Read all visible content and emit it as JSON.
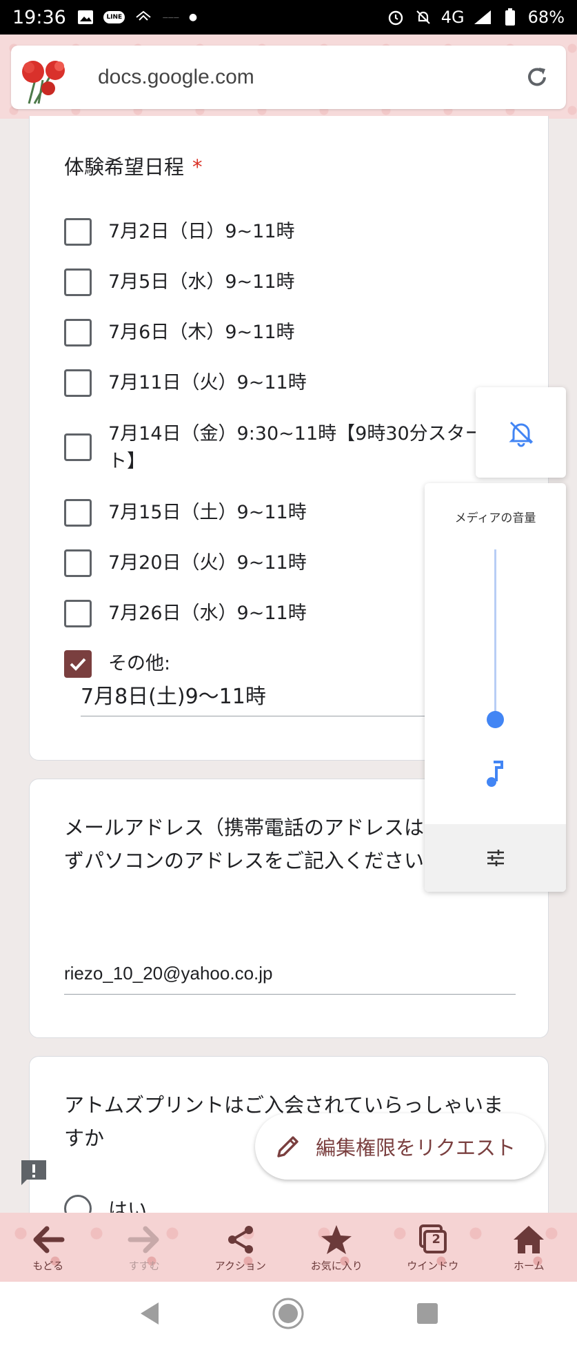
{
  "status_bar": {
    "time": "19:36",
    "network": "4G",
    "battery": "68%",
    "line_badge": "LINE"
  },
  "browser": {
    "url": "docs.google.com"
  },
  "form": {
    "schedule_question": {
      "title": "体験希望日程",
      "required_mark": "*",
      "options": [
        {
          "label": "7月2日（日）9~11時",
          "checked": false
        },
        {
          "label": "7月5日（水）9~11時",
          "checked": false
        },
        {
          "label": "7月6日（木）9~11時",
          "checked": false
        },
        {
          "label": "7月11日（火）9~11時",
          "checked": false
        },
        {
          "label": "7月14日（金）9:30~11時【9時30分スタート】",
          "checked": false
        },
        {
          "label": "7月15日（土）9~11時",
          "checked": false
        },
        {
          "label": "7月20日（火）9~11時",
          "checked": false
        },
        {
          "label": "7月26日（水）9~11時",
          "checked": false
        },
        {
          "label": "その他:",
          "checked": true
        }
      ],
      "other_value": "7月8日(土)9〜11時"
    },
    "email_question": {
      "title": "メールアドレス（携帯電話のアドレスは不可、必ずパソコンのアドレスをご記入ください）",
      "value": "riezo_10_20@yahoo.co.jp"
    },
    "membership_question": {
      "title": "アトムズプリントはご入会されていらっしゃいますか",
      "first_option": "はい"
    }
  },
  "volume_panel": {
    "title": "メディアの音量",
    "level": 0.0
  },
  "fab": {
    "label": "編集権限をリクエスト"
  },
  "bottom_bar": {
    "items": [
      {
        "label": "もどる",
        "icon": "arrow-left-icon"
      },
      {
        "label": "すすむ",
        "icon": "arrow-right-icon"
      },
      {
        "label": "アクション",
        "icon": "share-icon"
      },
      {
        "label": "お気に入り",
        "icon": "star-icon"
      },
      {
        "label": "ウインドウ",
        "icon": "windows-icon",
        "badge": "2"
      },
      {
        "label": "ホーム",
        "icon": "home-icon"
      }
    ]
  },
  "colors": {
    "accent": "#7a3f3f",
    "required": "#d93025",
    "volume": "#4285f4"
  }
}
